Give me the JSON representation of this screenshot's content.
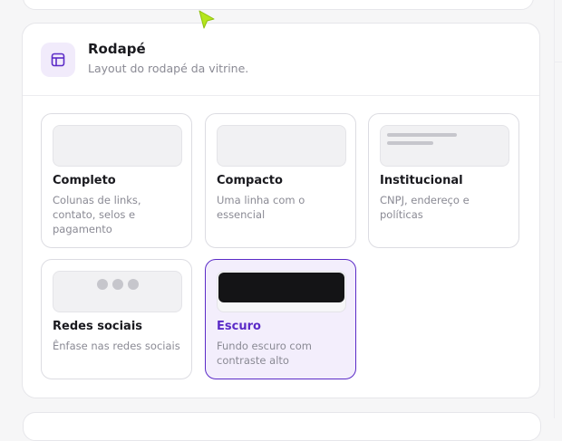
{
  "section": {
    "icon": "layout-icon",
    "title": "Rodapé",
    "subtitle": "Layout do rodapé da vitrine."
  },
  "options": [
    {
      "id": "completo",
      "title": "Completo",
      "description": "Colunas de links, contato, selos e pagamento",
      "selected": false,
      "preview": "blank"
    },
    {
      "id": "compacto",
      "title": "Compacto",
      "description": "Uma linha com o essencial",
      "selected": false,
      "preview": "blank"
    },
    {
      "id": "institucional",
      "title": "Institucional",
      "description": "CNPJ, endereço e políticas",
      "selected": false,
      "preview": "lines"
    },
    {
      "id": "redes-sociais",
      "title": "Redes sociais",
      "description": "Ênfase nas redes sociais",
      "selected": false,
      "preview": "dots"
    },
    {
      "id": "escuro",
      "title": "Escuro",
      "description": "Fundo escuro com contraste alto",
      "selected": true,
      "preview": "dark"
    }
  ],
  "colors": {
    "accent": "#5b2bc7",
    "selected_bg": "#f3eefc",
    "cursor": "#b5e61d"
  }
}
